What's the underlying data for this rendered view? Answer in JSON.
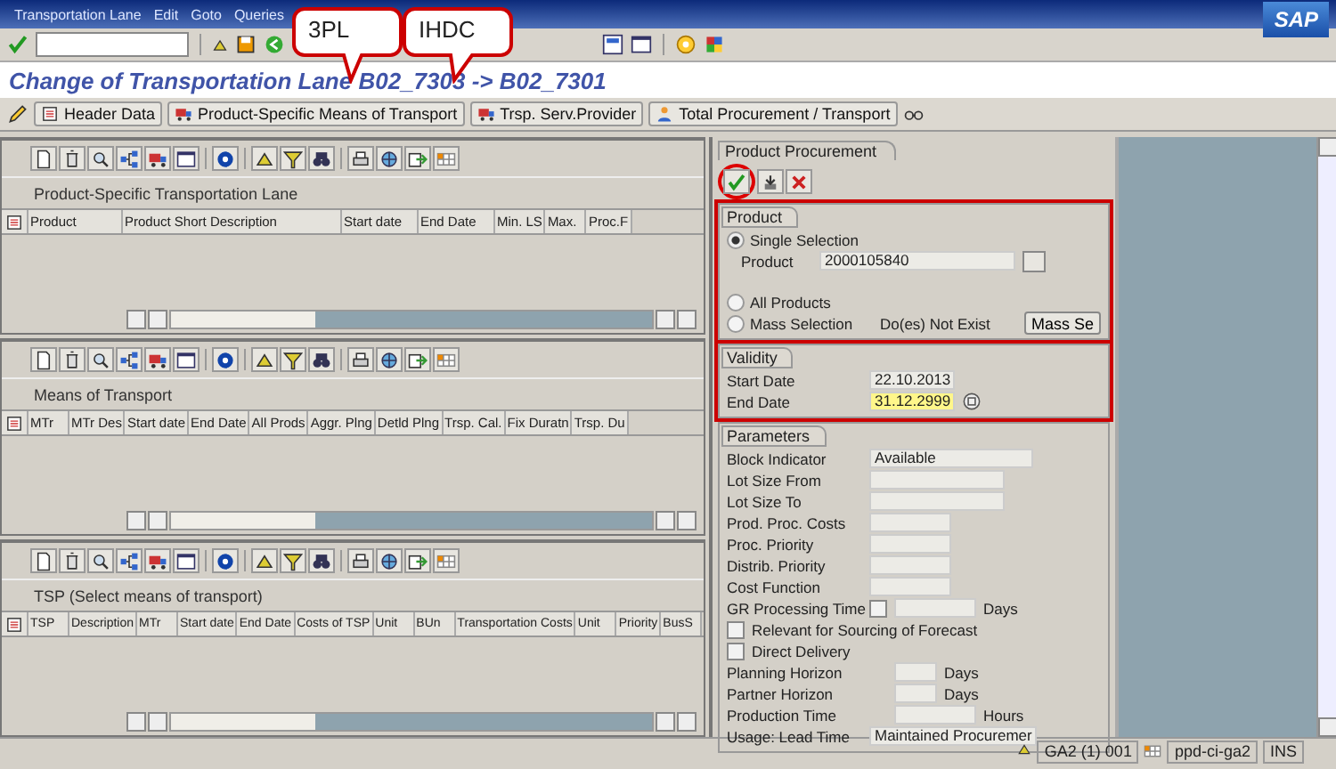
{
  "menu": [
    {
      "label": "Transportation Lane"
    },
    {
      "label": "Edit"
    },
    {
      "label": "Goto"
    },
    {
      "label": "Queries"
    }
  ],
  "logo": "SAP",
  "callouts": [
    {
      "text": "3PL"
    },
    {
      "text": "IHDC"
    }
  ],
  "title": "Change of Transportation Lane B02_7303 -> B02_7301",
  "app_toolbar": [
    {
      "label": "Header Data"
    },
    {
      "label": "Product-Specific Means of Transport"
    },
    {
      "label": "Trsp. Serv.Provider"
    },
    {
      "label": "Total Procurement / Transport"
    }
  ],
  "grids": [
    {
      "title": "Product-Specific Transportation Lane",
      "columns": [
        "Product",
        "Product Short Description",
        "Start date",
        "End Date",
        "Min. LS",
        "Max.",
        "Proc.F"
      ]
    },
    {
      "title": "Means of Transport",
      "columns": [
        "MTr",
        "MTr Des",
        "Start date",
        "End Date",
        "All Prods",
        "Aggr. Plng",
        "Detld Plng",
        "Trsp. Cal.",
        "Fix Duratn",
        "Trsp. Du"
      ]
    },
    {
      "title": "TSP (Select means of transport)",
      "columns": [
        "TSP",
        "Description",
        "MTr",
        "Start date",
        "End Date",
        "Costs of TSP",
        "Unit",
        "BUn",
        "Transportation Costs",
        "Unit",
        "Priority",
        "BusS"
      ]
    }
  ],
  "procurement": {
    "title": "Product Procurement",
    "product_group": {
      "title": "Product",
      "highlighted": true,
      "options": [
        {
          "label": "Single Selection",
          "selected": true
        },
        {
          "label": "All Products",
          "selected": false
        },
        {
          "label": "Mass Selection",
          "selected": false
        }
      ],
      "product_label": "Product",
      "product_value": "2000105840",
      "mass_status": "Do(es) Not Exist",
      "mass_button": "Mass Se"
    },
    "validity": {
      "title": "Validity",
      "highlighted": true,
      "start_label": "Start Date",
      "start_value": "22.10.2013",
      "end_label": "End Date",
      "end_value": "31.12.2999"
    },
    "parameters": {
      "title": "Parameters",
      "rows": [
        {
          "kind": "dropdown",
          "label": "Block Indicator",
          "value": "Available"
        },
        {
          "kind": "field",
          "label": "Lot Size From"
        },
        {
          "kind": "field",
          "label": "Lot Size To"
        },
        {
          "kind": "field",
          "label": "Prod. Proc. Costs"
        },
        {
          "kind": "field",
          "label": "Proc. Priority"
        },
        {
          "kind": "field",
          "label": "Distrib. Priority"
        },
        {
          "kind": "field",
          "label": "Cost Function"
        },
        {
          "kind": "check_field",
          "label": "GR Processing Time",
          "checked": false,
          "unit": "Days"
        },
        {
          "kind": "checkbox",
          "label": "Relevant for Sourcing of Forecast",
          "checked": false
        },
        {
          "kind": "checkbox",
          "label": "Direct Delivery",
          "checked": false
        },
        {
          "kind": "field",
          "label": "Planning Horizon",
          "unit": "Days"
        },
        {
          "kind": "field",
          "label": "Partner Horizon",
          "unit": "Days"
        },
        {
          "kind": "field",
          "label": "Production Time",
          "unit": "Hours"
        },
        {
          "kind": "dropdown",
          "label": "Usage: Lead Time",
          "value": "Maintained Procuremer"
        }
      ]
    }
  },
  "status_bar": {
    "system": "GA2 (1) 001",
    "server": "ppd-ci-ga2",
    "mode": "INS"
  }
}
